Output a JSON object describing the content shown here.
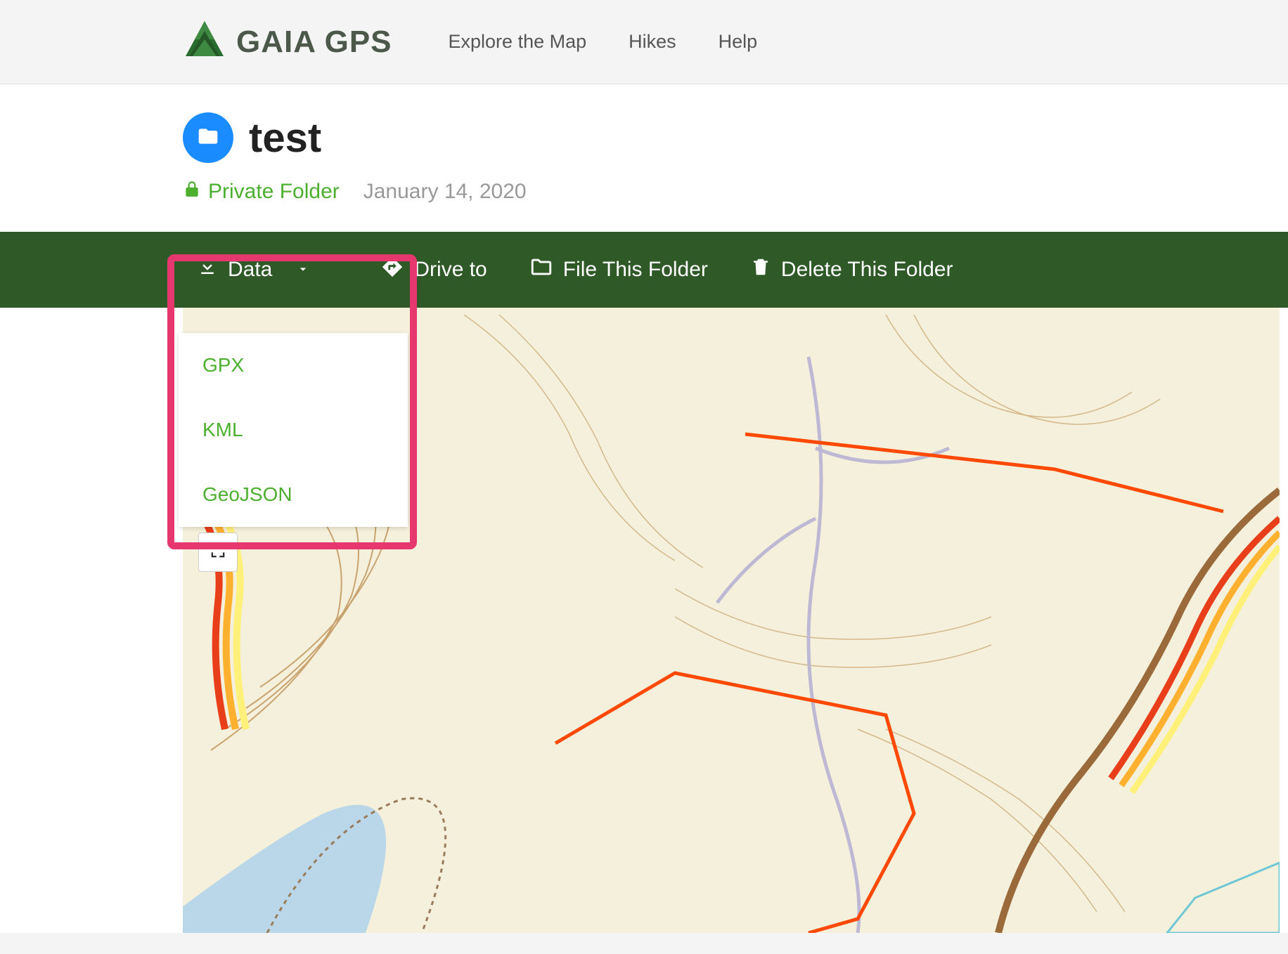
{
  "header": {
    "brand": "GAIA GPS",
    "nav": {
      "explore": "Explore the Map",
      "hikes": "Hikes",
      "help": "Help"
    }
  },
  "folder": {
    "title": "test",
    "privacy_label": "Private Folder",
    "date": "January 14, 2020"
  },
  "toolbar": {
    "data_label": "Data",
    "drive_label": "Drive to",
    "file_label": "File This Folder",
    "delete_label": "Delete This Folder"
  },
  "data_dropdown": {
    "items": {
      "gpx": "GPX",
      "kml": "KML",
      "geojson": "GeoJSON"
    }
  },
  "colors": {
    "brand_green": "#2f5a28",
    "link_green": "#4caf2e",
    "highlight_pink": "#e6376f",
    "folder_blue": "#1a8cff",
    "track_orange": "#ff4800"
  }
}
